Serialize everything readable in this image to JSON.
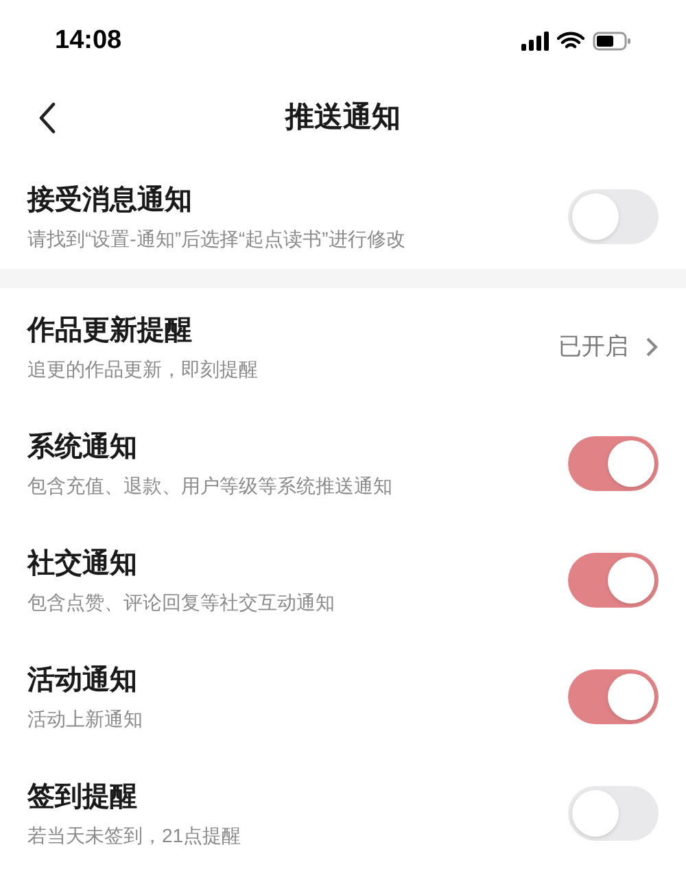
{
  "status_bar": {
    "time": "14:08"
  },
  "header": {
    "title": "推送通知"
  },
  "sections": [
    {
      "items": [
        {
          "kind": "toggle",
          "title": "接受消息通知",
          "subtitle": "请找到“设置-通知”后选择“起点读书”进行修改",
          "on": false
        }
      ]
    },
    {
      "items": [
        {
          "kind": "link",
          "title": "作品更新提醒",
          "subtitle": "追更的作品更新，即刻提醒",
          "value": "已开启"
        },
        {
          "kind": "toggle",
          "title": "系统通知",
          "subtitle": "包含充值、退款、用户等级等系统推送通知",
          "on": true
        },
        {
          "kind": "toggle",
          "title": "社交通知",
          "subtitle": "包含点赞、评论回复等社交互动通知",
          "on": true
        },
        {
          "kind": "toggle",
          "title": "活动通知",
          "subtitle": "活动上新通知",
          "on": true
        },
        {
          "kind": "toggle",
          "title": "签到提醒",
          "subtitle": "若当天未签到，21点提醒",
          "on": false
        }
      ]
    }
  ]
}
